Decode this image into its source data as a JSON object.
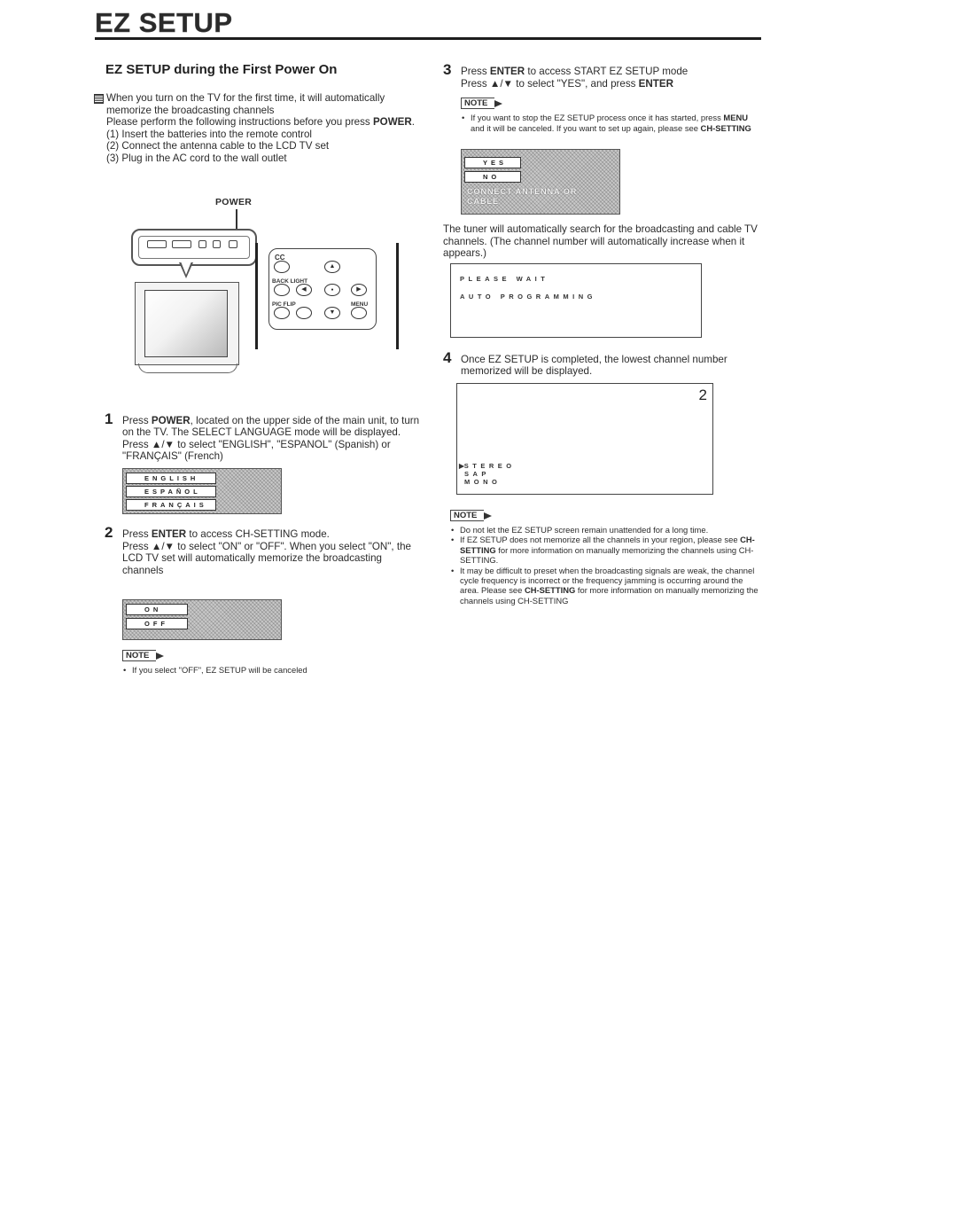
{
  "page": {
    "title": "EZ SETUP"
  },
  "left": {
    "heading": "EZ SETUP during the First Power On",
    "intro": {
      "line1": "When you turn on the TV for the first time, it will automatically memorize the broadcasting channels",
      "line2_prefix": "Please perform the following instructions before you press ",
      "line2_bold": "POWER",
      "line2_suffix": ".",
      "prereqs": [
        "(1) Insert the batteries into the remote control",
        "(2) Connect the antenna cable to the LCD TV set",
        "(3) Plug in the AC cord to the wall outlet"
      ]
    },
    "illustration": {
      "power_label": "POWER",
      "remote_labels": {
        "cc": "CC",
        "backlight": "BACK LIGHT",
        "picflip": "PIC FLIP",
        "menu": "MENU"
      }
    },
    "step1": {
      "num": "1",
      "text_a": "Press ",
      "bold_a": "POWER",
      "text_b": ", located on the upper side of the main unit, to turn on the TV. The SELECT LANGUAGE mode will be displayed.",
      "text_c": "Press ▲/▼ to select \"ENGLISH\", \"ESPANOL\" (Spanish) or \"FRANÇAIS\" (French)",
      "osd_items": [
        "ENGLISH",
        "ESPAÑOL",
        "FRANÇAIS"
      ]
    },
    "step2": {
      "num": "2",
      "text_a": "Press ",
      "bold_a": "ENTER",
      "text_b": " to access CH-SETTING mode.",
      "text_c": "Press ▲/▼ to select \"ON\" or \"OFF\". When you select \"ON\", the LCD TV set will automatically memorize the broadcasting channels",
      "osd_items": [
        "ON",
        "OFF"
      ],
      "note_label": "NOTE",
      "notes": [
        "If you select \"OFF\", EZ SETUP will be canceled"
      ]
    }
  },
  "right": {
    "step3": {
      "num": "3",
      "text_a": "Press ",
      "bold_a": "ENTER",
      "text_b": " to access START EZ SETUP mode",
      "text_c": "Press ▲/▼ to select \"YES\", and press ",
      "bold_c": "ENTER",
      "note_label": "NOTE",
      "note_a": "If you want to stop the EZ SETUP process once it has started, press ",
      "note_bold_a": "MENU",
      "note_b": " and it will be canceled. If you want to set up again, please see ",
      "note_bold_b": "CH-SETTING",
      "osd_items": [
        "YES",
        "NO"
      ],
      "osd_message": "CONNECT ANTENNA OR CABLE",
      "tuner_text": "The tuner will automatically search for the broadcasting and cable TV channels. (The channel number will automatically increase when it appears.)",
      "progress_lines": [
        "PLEASE WAIT",
        "AUTO PROGRAMMING"
      ]
    },
    "step4": {
      "num": "4",
      "text": "Once EZ SETUP is completed, the lowest channel number memorized will be displayed.",
      "channel_number": "2",
      "audio_modes": [
        "STEREO",
        "SAP",
        "MONO"
      ],
      "selected_audio_mode": "STEREO",
      "note_label": "NOTE",
      "note1": "Do not let the EZ SETUP screen remain unattended for a long time.",
      "note2_a": "If EZ SETUP does not memorize all the channels in your region, please see ",
      "note2_bold": "CH-SETTING",
      "note2_b": " for more information on manually memorizing the channels using CH-SETTING.",
      "note3_a": "It may be difficult to preset when the broadcasting signals are weak, the channel cycle frequency is incorrect or the frequency jamming is occurring around the area. Please see ",
      "note3_bold": "CH-SETTING",
      "note3_b": " for more information on manually memorizing the channels using CH-SETTING"
    }
  }
}
